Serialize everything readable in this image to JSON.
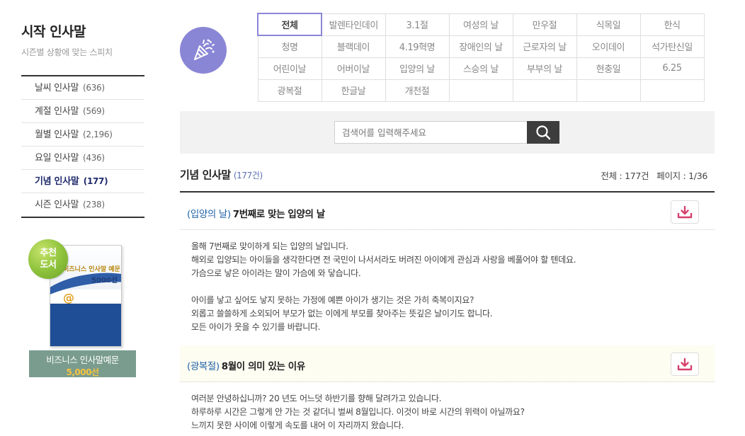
{
  "sidebar": {
    "title": "시작 인사말",
    "subtitle": "시즌별 상황에 맞는 스피치",
    "items": [
      {
        "label": "날씨 인사말",
        "count": "(636)"
      },
      {
        "label": "계절 인사말",
        "count": "(569)"
      },
      {
        "label": "월별 인사말",
        "count": "(2,196)"
      },
      {
        "label": "요일 인사말",
        "count": "(436)"
      },
      {
        "label": "기념 인사말",
        "count": "(177)"
      },
      {
        "label": "시즌 인사말",
        "count": "(238)"
      }
    ],
    "active_index": 4
  },
  "promo": {
    "badge_line1": "추천",
    "badge_line2": "도서",
    "book_title_small": "비즈니스 인사말 예문",
    "book_title_big": "5000선",
    "caption_line1": "비즈니스 인사말예문",
    "caption_line2": "5,000선"
  },
  "category_icon": "party-popper-icon",
  "categories": {
    "rows": [
      [
        "전체",
        "발렌타인데이",
        "3.1절",
        "여성의 날",
        "만우절",
        "식목일",
        "한식"
      ],
      [
        "청명",
        "블랙데이",
        "4.19혁명",
        "장애인의 날",
        "근로자의 날",
        "오이데이",
        "석가탄신일"
      ],
      [
        "어린이날",
        "어버이날",
        "입양의 날",
        "스승의 날",
        "부부의 날",
        "현충일",
        "6.25"
      ],
      [
        "광복절",
        "한글날",
        "개천절",
        "",
        "",
        "",
        ""
      ]
    ],
    "active": "전체"
  },
  "search": {
    "placeholder": "검색어를 입력해주세요",
    "value": "",
    "button_icon": "search-icon"
  },
  "list": {
    "title": "기념 인사말",
    "count": "(177건)",
    "total_label": "전체 : 177건",
    "page_label": "페이지 : 1/36"
  },
  "articles": [
    {
      "tag": "(입양의 날)",
      "title": "7번째로 맞는 입양의 날",
      "download_icon": "download-icon",
      "paragraphs": [
        [
          "올해 7번째로 맞이하게 되는 입양의 날입니다.",
          "해외로 입양되는 아이들을 생각한다면 전 국민이 나서서라도 버려진 아이에게 관심과 사랑을 베풀어야 할 텐데요.",
          "가슴으로 낳은 아이라는 말이 가슴에 와 닿습니다."
        ],
        [
          "아이를 낳고 싶어도 낳지 못하는 가정에 예쁜 아이가 생기는 것은 가히 축복이지요?",
          "외롭고 쓸쓸하게 소외되어 부모가 없는 이에게 부모를 찾아주는 뜻깊은 날이기도 합니다.",
          "모든 아이가 웃을 수 있기를 바랍니다."
        ]
      ]
    },
    {
      "tag": "(광복절)",
      "title": "8월이 의미 있는 이유",
      "download_icon": "download-icon",
      "paragraphs": [
        [
          "여러분 안녕하십니까? 20 년도 어느덧 하반기를 향해 달려가고 있습니다.",
          "하루하루 시간은 그렇게 안 가는 것 같더니 벌써 8월입니다. 이것이 바로 시간의 위력이 아닐까요?",
          "느끼지 못한 사이에 이렇게 속도를 내어 이 자리까지 왔습니다."
        ]
      ]
    }
  ],
  "colors": {
    "accent": "#8a86d6",
    "tag_blue": "#1f62a8",
    "download_red": "#d6416b",
    "search_button": "#3d3d3d"
  }
}
